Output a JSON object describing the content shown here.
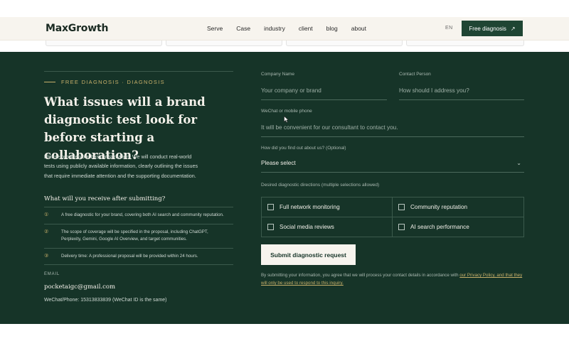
{
  "header": {
    "logo": "MaxGrowth",
    "nav": [
      "Serve",
      "Case",
      "industry",
      "client",
      "blog",
      "about"
    ],
    "lang": "EN",
    "cta_label": "Free diagnosis",
    "cta_icon": "arrow-up-right-icon"
  },
  "left": {
    "eyebrow": "FREE DIAGNOSIS · DIAGNOSIS",
    "headline": "What issues will a brand diagnostic test look for before starting a collaboration?",
    "intro": "Please provide your basic information. We will conduct real-world tests using publicly available information, clearly outlining the issues that require immediate attention and the supporting documentation.",
    "receive_title": "What will you receive after submitting?",
    "benefits": [
      {
        "num": "①",
        "text": "A free diagnostic for your brand, covering both AI search and community reputation."
      },
      {
        "num": "②",
        "text": "The scope of coverage will be specified in the proposal, including ChatGPT, Perplexity, Gemini, Google AI Overview, and target communities."
      },
      {
        "num": "③",
        "text": "Delivery time: A professional proposal will be provided within 24 hours."
      }
    ],
    "email_label": "EMAIL",
    "email": "pocketaigc@gmail.com",
    "wechat": "WeChat/Phone: 15313833839 (WeChat ID is the same)"
  },
  "form": {
    "company_label": "Company Name",
    "company_placeholder": "Your company or brand",
    "contact_label": "Contact Person",
    "contact_placeholder": "How should I address you?",
    "wechat_label": "WeChat or mobile phone",
    "wechat_placeholder": "It will be convenient for our consultant to contact you.",
    "source_label": "How did you find out about us? (Optional)",
    "source_value": "Please select",
    "directions_label": "Desired diagnostic directions (multiple selections allowed)",
    "options": [
      "Full network monitoring",
      "Community reputation",
      "Social media reviews",
      "AI search performance"
    ],
    "submit_label": "Submit diagnostic request",
    "consent_text": "By submitting your information, you agree that we will process your contact details in accordance with ",
    "consent_link": "our Privacy Policy",
    "consent_tail": ", and that they will only be used to respond to this inquiry."
  },
  "colors": {
    "dark_green": "#163428",
    "accent_gold": "#c8b06a",
    "cta_green": "#1f4533",
    "header_bg": "#f7f4ee"
  }
}
